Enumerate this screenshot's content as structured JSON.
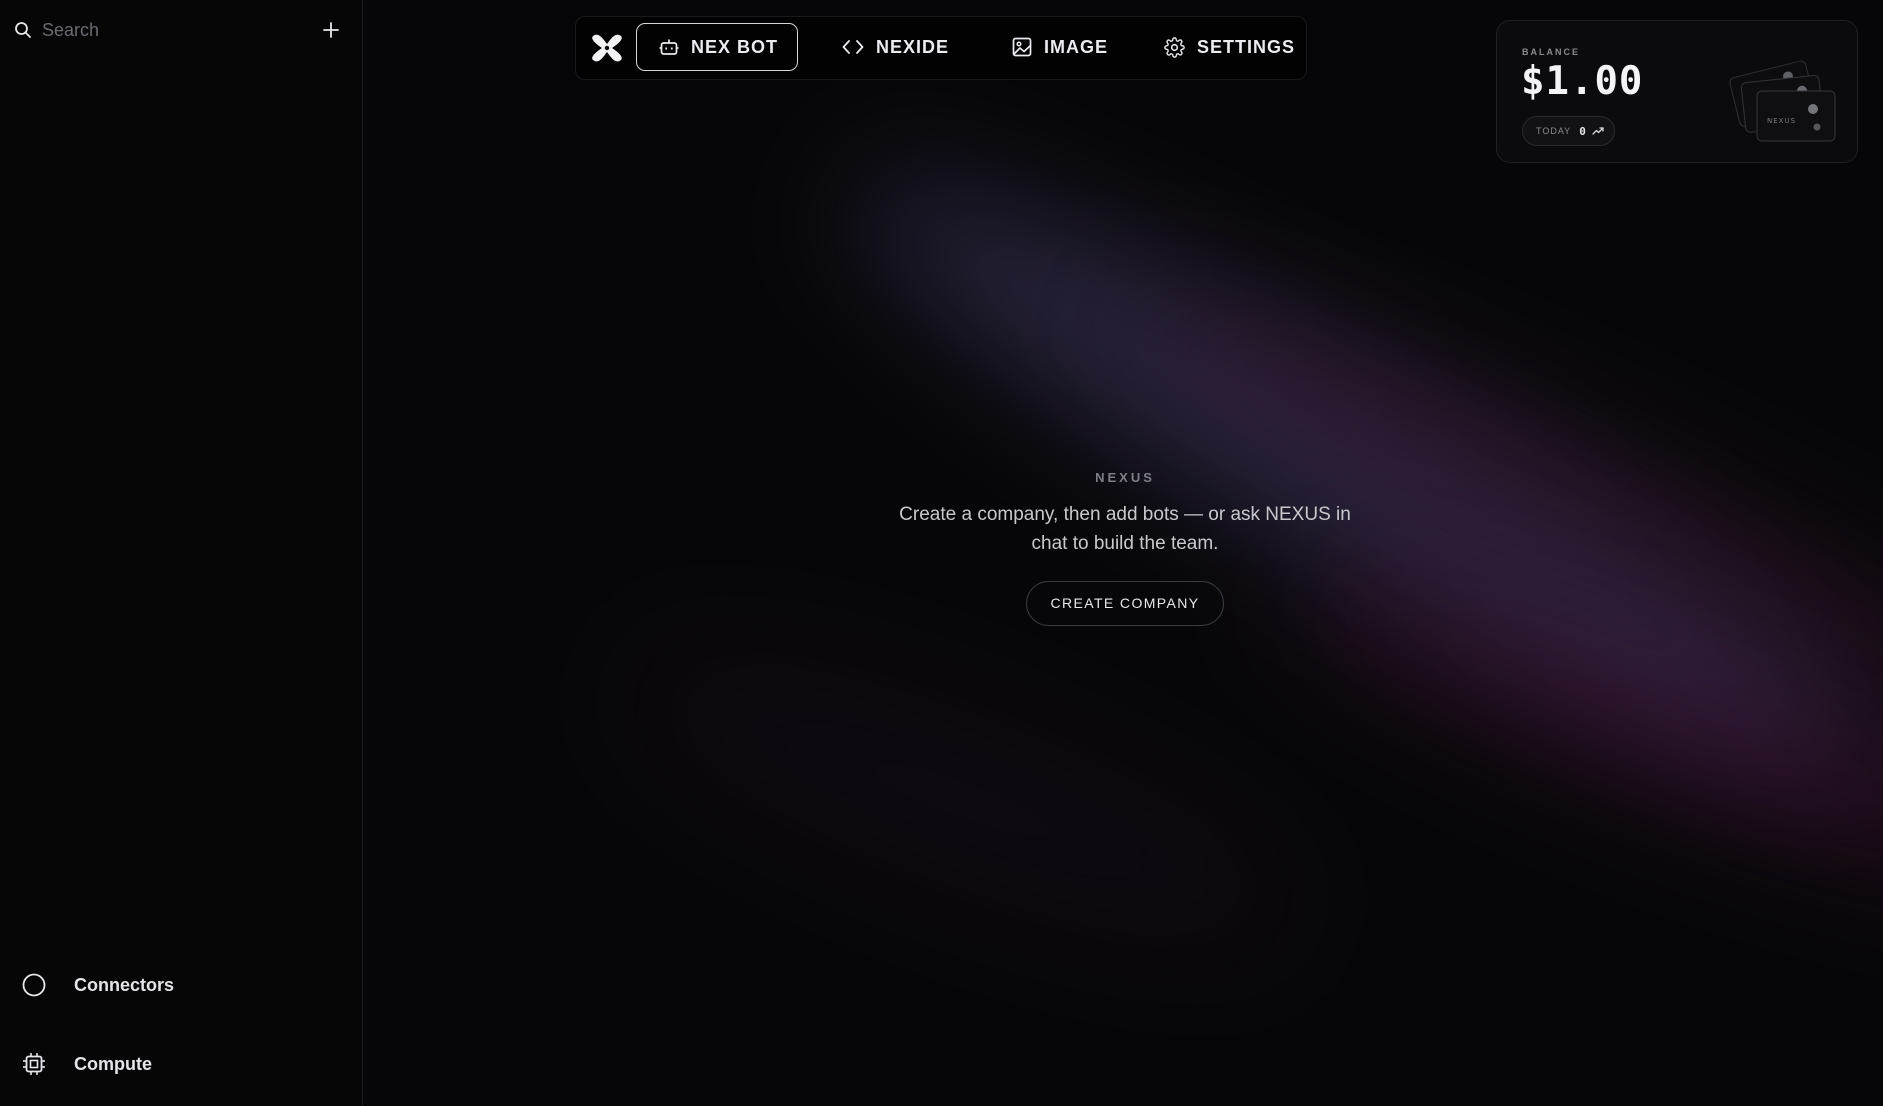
{
  "sidebar": {
    "search": {
      "placeholder": "Search",
      "value": ""
    },
    "footer": [
      {
        "label": "Connectors",
        "icon": "circle-icon"
      },
      {
        "label": "Compute",
        "icon": "chip-icon"
      }
    ]
  },
  "topnav": {
    "logo_icon": "x-logo-icon",
    "tabs": [
      {
        "label": "NEX BOT",
        "icon": "bot-icon",
        "active": true
      },
      {
        "label": "NEXIDE",
        "icon": "code-icon",
        "active": false
      },
      {
        "label": "IMAGE",
        "icon": "image-icon",
        "active": false
      },
      {
        "label": "SETTINGS",
        "icon": "gear-icon",
        "active": false
      }
    ]
  },
  "balance": {
    "label": "BALANCE",
    "amount": "$1.00",
    "today_label": "TODAY",
    "today_value": "0",
    "card_art_text": "NEXUS"
  },
  "main": {
    "eyebrow": "NEXUS",
    "description": "Create a company, then add bots — or ask NEXUS in chat to build the team.",
    "create_button": "CREATE COMPANY"
  },
  "colors": {
    "background": "#060608",
    "text": "#e8e8ec",
    "muted": "#7e7e86",
    "glow_violet": "#463e69",
    "glow_magenta": "#4e143e"
  }
}
